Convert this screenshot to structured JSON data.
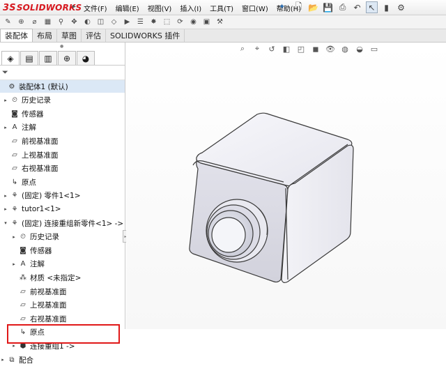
{
  "app": {
    "logo_mark": "3S",
    "logo_text": "SOLIDWORKS"
  },
  "menu": [
    "文件(F)",
    "编辑(E)",
    "视图(V)",
    "插入(I)",
    "工具(T)",
    "窗口(W)",
    "帮助(H)"
  ],
  "tabs": [
    "装配体",
    "布局",
    "草图",
    "评估",
    "SOLIDWORKS 插件"
  ],
  "active_tab": 0,
  "tree": {
    "root": "装配体1 (默认)",
    "items": [
      {
        "label": "历史记录",
        "icon": "history-icon",
        "level": 1,
        "expand": true
      },
      {
        "label": "传感器",
        "icon": "sensor-icon",
        "level": 1,
        "expand": false
      },
      {
        "label": "注解",
        "icon": "annotation-icon",
        "level": 1,
        "expand": true
      },
      {
        "label": "前视基准面",
        "icon": "plane-icon",
        "level": 1,
        "expand": false
      },
      {
        "label": "上视基准面",
        "icon": "plane-icon",
        "level": 1,
        "expand": false
      },
      {
        "label": "右视基准面",
        "icon": "plane-icon",
        "level": 1,
        "expand": false
      },
      {
        "label": "原点",
        "icon": "origin-icon",
        "level": 1,
        "expand": false
      },
      {
        "label": "(固定) 零件1<1>",
        "icon": "part-icon",
        "level": 1,
        "expand": true
      },
      {
        "label": "tutor1<1>",
        "icon": "part-icon",
        "level": 1,
        "expand": true
      },
      {
        "label": "(固定) 连接重组新零件<1> ->",
        "icon": "part-icon",
        "level": 1,
        "expand": true,
        "open": true
      },
      {
        "label": "历史记录",
        "icon": "history-icon",
        "level": 2,
        "expand": true
      },
      {
        "label": "传感器",
        "icon": "sensor-icon",
        "level": 2,
        "expand": false
      },
      {
        "label": "注解",
        "icon": "annotation-icon",
        "level": 2,
        "expand": true
      },
      {
        "label": "材质 <未指定>",
        "icon": "material-icon",
        "level": 2,
        "expand": false
      },
      {
        "label": "前视基准面",
        "icon": "plane-icon",
        "level": 2,
        "expand": false
      },
      {
        "label": "上视基准面",
        "icon": "plane-icon",
        "level": 2,
        "expand": false
      },
      {
        "label": "右视基准面",
        "icon": "plane-icon",
        "level": 2,
        "expand": false
      },
      {
        "label": "原点",
        "icon": "origin-icon",
        "level": 2,
        "expand": false
      },
      {
        "label": "连接重组1 ->",
        "icon": "join-feature-icon",
        "level": 2,
        "expand": true
      },
      {
        "label": "配合",
        "icon": "mates-icon",
        "level": 0,
        "expand": true
      }
    ]
  },
  "colors": {
    "brand_red": "#d71920",
    "highlight_box": "#e01818",
    "selection": "#dbe8f6"
  }
}
